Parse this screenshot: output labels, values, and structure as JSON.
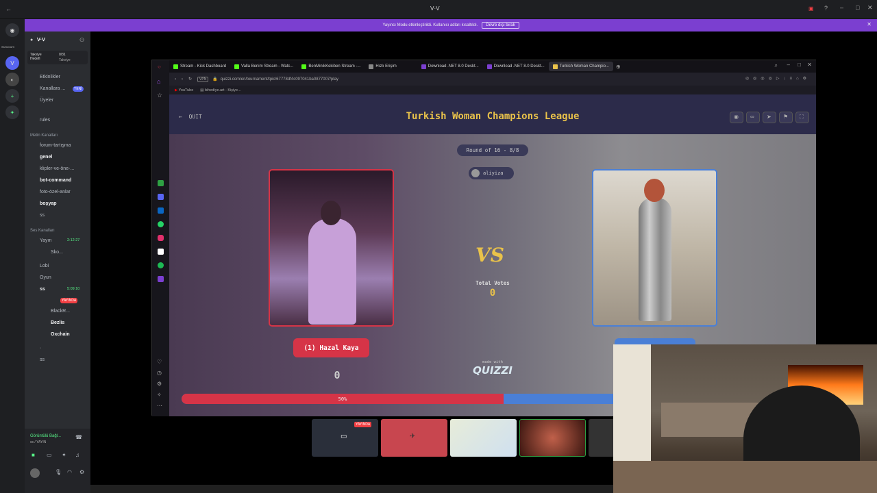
{
  "discord": {
    "topbar_title": "ᐯ·ᐯ",
    "banner": {
      "text": "Yayıncı Modu etkinleştirildi. Kullanıcı adları kısaltıldı.",
      "button": "Devre dışı bırak"
    },
    "rail_label": "Sunucum",
    "server_name": "ᐯ·ᐯ",
    "boost": {
      "label": "Takviye Hedefi",
      "progress": "0/31",
      "sub": "Takviye"
    },
    "channels": {
      "events": "Etkinlikler",
      "channels_roles": "Kanallara ...",
      "new_badge": "YENİ",
      "members": "Üyeler",
      "rules": "rules",
      "text_category": "Metin Kanalları",
      "text": [
        "forum-tartışma",
        "genel",
        "klipler-ve-öne-...",
        "bot-command",
        "foto-özel-anlar",
        "boşyap",
        "ss"
      ],
      "voice_category": "Ses Kanalları",
      "yayin": "Yayın",
      "yayin_time": "2:12:27",
      "sko_user": "Sko...",
      "lobi": "Lobi",
      "oyun": "Oyun",
      "ss_voice": "ss",
      "ss_time": "5:09:10",
      "live_badge": "YAYINDA",
      "users": [
        "BlackR...",
        "Bezlis",
        "Oxchain"
      ],
      "extra_voice": [
        "·",
        "ss"
      ]
    },
    "voice_status": {
      "title": "Görüntülü Bağl...",
      "sub": "ss / YAYIN"
    }
  },
  "browser": {
    "tabs": [
      {
        "label": "Stream - Kick Dashboard",
        "icon_color": "#53fc18"
      },
      {
        "label": "Valla Benim Stream - Watc...",
        "icon_color": "#53fc18"
      },
      {
        "label": "BenMinikKekiben Stream -...",
        "icon_color": "#53fc18"
      },
      {
        "label": "Hızlı Erişim",
        "icon_color": "#888888"
      },
      {
        "label": "Download .NET 8.0 Deskt...",
        "icon_color": "#7b3fd0"
      },
      {
        "label": "Download .NET 8.0 Deskt...",
        "icon_color": "#7b3fd0"
      },
      {
        "label": "Turkish Woman Champio...",
        "icon_color": "#e9c24a"
      }
    ],
    "url": "quizzi.com/en/tournament/tpic/67778df4c097041ba0877007/play",
    "vpn": "VPN",
    "bookmarks": [
      "YouTube",
      "bihediye.art - Kişiye..."
    ]
  },
  "quiz": {
    "quit": "QUIT",
    "title": "Turkish Woman Champions League",
    "round": "Round of 16 - 8/8",
    "creator": "aliyiza",
    "vs": "VS",
    "total_votes_label": "Total Votes",
    "total_votes": "0",
    "left_name": "(1) Hazal Kaya",
    "left_score": "0",
    "made_with": "made with",
    "brand": "QUIZZI",
    "percent": "50%",
    "percent_value": 0.5
  },
  "thumbs": {
    "live_badge": "YAYINDA"
  },
  "colors": {
    "accent_gold": "#e9c24a",
    "left_red": "#d63447",
    "right_blue": "#4a7fd6",
    "discord_purple": "#7b3fd0"
  }
}
